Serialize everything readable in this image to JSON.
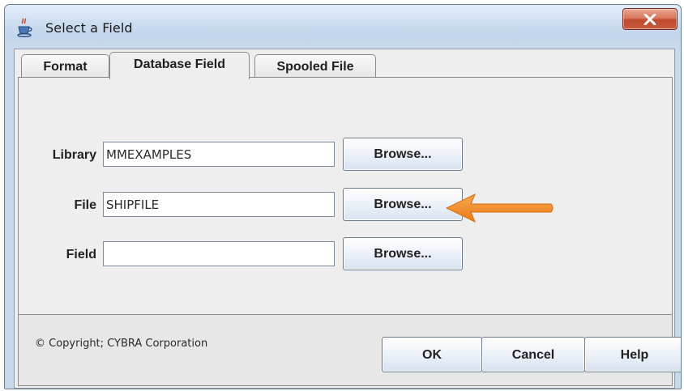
{
  "window": {
    "title": "Select a Field",
    "title_icon": "java-cup-icon",
    "close_icon": "close-icon"
  },
  "tabs": [
    {
      "label": "Format",
      "active": false
    },
    {
      "label": "Database Field",
      "active": true
    },
    {
      "label": "Spooled File",
      "active": false
    }
  ],
  "form": {
    "library": {
      "label": "Library",
      "value": "MMEXAMPLES",
      "button": "Browse..."
    },
    "file": {
      "label": "File",
      "value": "SHIPFILE",
      "button": "Browse..."
    },
    "field": {
      "label": "Field",
      "value": "",
      "button": "Browse..."
    }
  },
  "annotation": {
    "icon": "orange-arrow-icon",
    "color": "#f08a24"
  },
  "footer": {
    "copyright": "© Copyright; CYBRA Corporation",
    "ok_label": "OK",
    "cancel_label": "Cancel",
    "help_label": "Help"
  },
  "colors": {
    "titlebar": "#c9daee",
    "close_button": "#c85b3e",
    "panel_background": "#eeeeee",
    "arrow": "#f08a24"
  }
}
